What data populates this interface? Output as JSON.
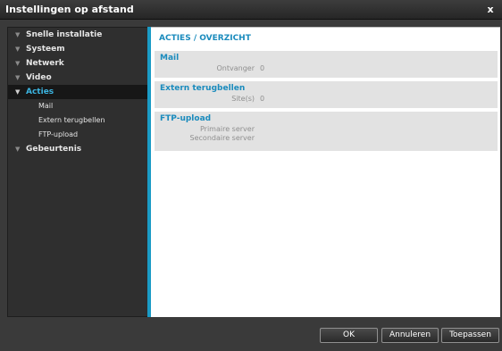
{
  "window": {
    "title": "Instellingen op afstand",
    "close_label": "x"
  },
  "sidebar": {
    "items": [
      {
        "label": "Snelle installatie"
      },
      {
        "label": "Systeem"
      },
      {
        "label": "Netwerk"
      },
      {
        "label": "Video"
      },
      {
        "label": "Acties",
        "active": true,
        "children": [
          "Mail",
          "Extern terugbellen",
          "FTP-upload"
        ]
      },
      {
        "label": "Gebeurtenis"
      }
    ],
    "expander_glyph": "▼"
  },
  "content": {
    "title": "ACTIES / OVERZICHT",
    "sections": [
      {
        "title": "Mail",
        "rows": [
          {
            "label": "Ontvanger",
            "value": "0"
          }
        ]
      },
      {
        "title": "Extern terugbellen",
        "rows": [
          {
            "label": "Site(s)",
            "value": "0"
          }
        ]
      },
      {
        "title": "FTP-upload",
        "rows": [
          {
            "label": "Primaire server",
            "value": ""
          },
          {
            "label": "Secondaire server",
            "value": ""
          }
        ]
      }
    ]
  },
  "buttons": {
    "ok": "OK",
    "cancel": "Annuleren",
    "apply": "Toepassen"
  },
  "colors": {
    "accent": "#1a9bc6",
    "active_text": "#3bb4e0",
    "section_bg": "#e2e2e2"
  }
}
